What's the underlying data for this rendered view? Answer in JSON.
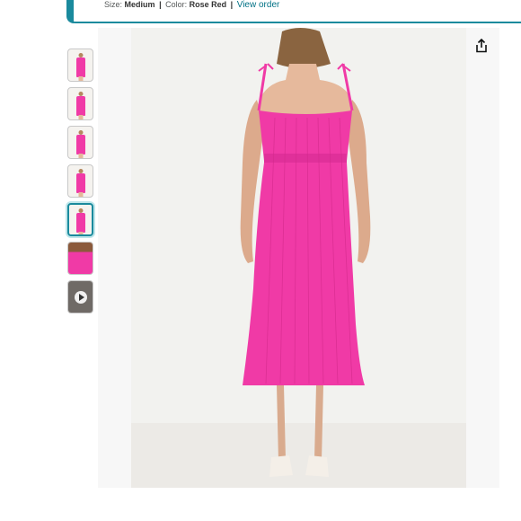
{
  "order": {
    "size_label": "Size:",
    "size_value": "Medium",
    "color_label": "Color:",
    "color_value": "Rose Red",
    "separator": "|",
    "view_order": "View order"
  },
  "gallery": {
    "selected_index": 4,
    "thumbnails": [
      "dress-front",
      "dress-back",
      "dress-side",
      "dress-full",
      "dress-back-selected",
      "dress-closeup",
      "video"
    ]
  },
  "colors": {
    "accent": "#1a8a9d",
    "dress": "#f03aa6",
    "link": "#007185"
  },
  "icons": {
    "share": "share-icon",
    "play": "play-icon"
  }
}
